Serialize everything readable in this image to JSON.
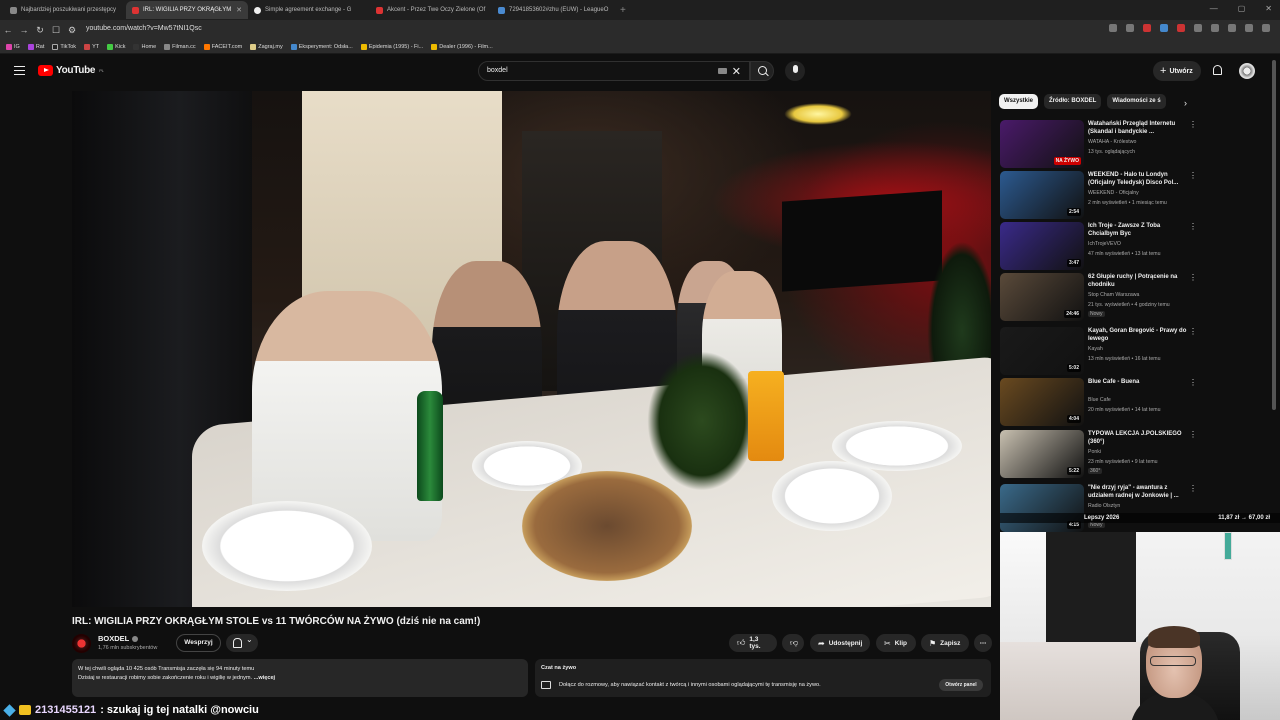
{
  "browser": {
    "tabs": [
      {
        "label": "Najbardziej poszukiwani przestępcy"
      },
      {
        "label": "IRL: WIGILIA PRZY OKRĄGŁYM"
      },
      {
        "label": "Simple agreement exchange - G"
      },
      {
        "label": "Akcent - Przez Twe Oczy Zielone (Of"
      },
      {
        "label": "72941853602#zhu (EUW) - LeagueO"
      }
    ],
    "url": "youtube.com/watch?v=Mw57tNI1Qsc",
    "bookmarks": [
      "IG",
      "Rat",
      "TikTok",
      "YT",
      "Kick",
      "Home",
      "Filman.cc",
      "FACEIT.com",
      "Zagraj.my",
      "Eksperyment: Odsła...",
      "Epidemia (1995) - Fi...",
      "Dealer (1996) - Film..."
    ]
  },
  "youtube": {
    "logo_text": "YouTube",
    "logo_region": "PL",
    "search_value": "boxdel",
    "create_label": "Utwórz"
  },
  "video": {
    "title": "IRL: WIGILIA PRZY OKRĄGŁYM STOLE vs 11 TWÓRCÓW NA ŻYWO (dziś nie na cam!)",
    "channel": "BOXDEL",
    "subscribers": "1,76 mln subskrybentów",
    "support_label": "Wesprzyj",
    "likes": "1,3 tys.",
    "share_label": "Udostępnij",
    "clip_label": "Klip",
    "save_label": "Zapisz",
    "more_label": "⋯",
    "description_line1": "W tej chwili ogląda 10 425 osób  Transmisja zaczęła się 94 minuty temu",
    "description_line2": "Dzisiaj w restauracji robimy sobie zakończenie roku i wigilię w jednym. ",
    "description_more": "...więcej"
  },
  "live_chat": {
    "title": "Czat na żywo",
    "text": "Dołącz do rozmowy, aby nawiązać kontakt z twórcą i innymi osobami oglądającymi tę transmisję na żywo.",
    "open_panel": "Otwórz panel"
  },
  "chips": [
    "Wszystkie",
    "Źródło: BOXDEL",
    "Wiadomości ze ś"
  ],
  "recommendations": [
    {
      "title": "Watahański Przegląd Internetu (Skandal i bandyckie ...",
      "channel": "WATAHA - Królestwo",
      "meta": "13 tys. oglądających",
      "badge": "NA ŻYWO",
      "thumb": "#4a1a6a"
    },
    {
      "title": "WEEKEND - Halo tu Londyn (Oficjalny Teledysk) Disco Pol...",
      "channel": "WEEKEND - Oficjalny",
      "meta": "2 mln wyświetleń • 1 miesiąc temu",
      "badge": "2:54",
      "thumb": "#2c5a90"
    },
    {
      "title": "Ich Troje - Zawsze Z Toba Chcialbym Byc",
      "channel": "IchTrojeVEVO",
      "meta": "47 mln wyświetleń • 13 lat temu",
      "badge": "3:47",
      "thumb": "#3a2a8a"
    },
    {
      "title": "62 Głupie ruchy | Potrącenie na chodniku",
      "channel": "Stop Cham Warszawa",
      "meta": "21 tys. wyświetleń • 4 godziny temu",
      "extra": "Nowy",
      "badge": "24:46",
      "thumb": "#5a4a3a"
    },
    {
      "title": "Kayah, Goran Bregović - Prawy do lewego",
      "channel": "Kayah",
      "meta": "13 mln wyświetleń • 16 lat temu",
      "badge": "5:02",
      "thumb": "#1a1a1a"
    },
    {
      "title": "Blue Cafe - Buena",
      "channel": "Blue Cafe",
      "meta": "20 mln wyświetleń • 14 lat temu",
      "badge": "4:04",
      "thumb": "#6a4a20"
    },
    {
      "title": "TYPOWA LEKCJA J.POLSKIEGO (360°)",
      "channel": "Ponki",
      "meta": "23 mln wyświetleń • 9 lat temu",
      "extra": "360°",
      "badge": "5:22",
      "thumb": "#c8c0b0"
    },
    {
      "title": "\"Nie drzyj ryja\" - awantura z udziałem radnej w Jonkowie | ...",
      "channel": "Radio Olsztyn",
      "meta": "",
      "extra": "Nowy",
      "badge": "4:15",
      "thumb": "#3a6a8a"
    }
  ],
  "overlay": {
    "left": "Lepszy 2026",
    "right": "11,87 zł → 67,00 zł"
  },
  "stream_chat": {
    "user": "2131455121",
    "message": ": szukaj ig tej natalki @nowciu"
  }
}
